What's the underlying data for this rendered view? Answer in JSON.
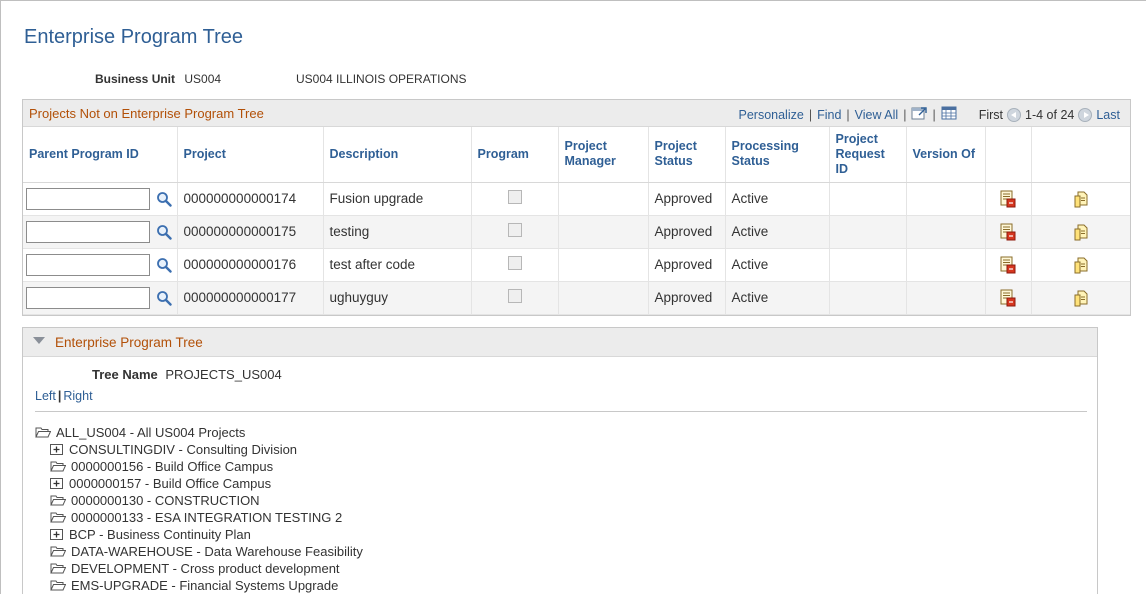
{
  "page": {
    "title": "Enterprise Program Tree"
  },
  "business_unit": {
    "label": "Business Unit",
    "code": "US004",
    "description": "US004 ILLINOIS OPERATIONS"
  },
  "grid": {
    "title": "Projects Not on Enterprise Program Tree",
    "nav": {
      "personalize": "Personalize",
      "find": "Find",
      "view_all": "View All",
      "first": "First",
      "range": "1-4 of 24",
      "last": "Last"
    },
    "columns": {
      "parent_program_id": "Parent Program ID",
      "project": "Project",
      "description": "Description",
      "program": "Program",
      "project_manager": "Project Manager",
      "project_status": "Project Status",
      "processing_status": "Processing Status",
      "project_request_id": "Project Request ID",
      "version_of": "Version Of"
    },
    "rows": [
      {
        "parent_program_id": "",
        "project": "000000000000174",
        "description": "Fusion upgrade",
        "program_checked": false,
        "project_manager": "",
        "project_status": "Approved",
        "processing_status": "Active",
        "project_request_id": "",
        "version_of": ""
      },
      {
        "parent_program_id": "",
        "project": "000000000000175",
        "description": "testing",
        "program_checked": false,
        "project_manager": "",
        "project_status": "Approved",
        "processing_status": "Active",
        "project_request_id": "",
        "version_of": ""
      },
      {
        "parent_program_id": "",
        "project": "000000000000176",
        "description": "test after code",
        "program_checked": false,
        "project_manager": "",
        "project_status": "Approved",
        "processing_status": "Active",
        "project_request_id": "",
        "version_of": ""
      },
      {
        "parent_program_id": "",
        "project": "000000000000177",
        "description": "ughuyguy",
        "program_checked": false,
        "project_manager": "",
        "project_status": "Approved",
        "processing_status": "Active",
        "project_request_id": "",
        "version_of": ""
      }
    ]
  },
  "tree": {
    "section_title": "Enterprise Program Tree",
    "tree_name_label": "Tree Name",
    "tree_name": "PROJECTS_US004",
    "left": "Left",
    "right": "Right",
    "root": {
      "label": "ALL_US004 - All US004 Projects",
      "icon": "folder-open-icon"
    },
    "nodes": [
      {
        "label": "CONSULTINGDIV - Consulting Division",
        "icon": "expand-plus-icon"
      },
      {
        "label": "0000000156 - Build Office Campus",
        "icon": "folder-open-icon"
      },
      {
        "label": "0000000157 - Build Office Campus",
        "icon": "expand-plus-icon"
      },
      {
        "label": "0000000130 - CONSTRUCTION",
        "icon": "folder-open-icon"
      },
      {
        "label": "0000000133 - ESA INTEGRATION TESTING 2",
        "icon": "folder-open-icon"
      },
      {
        "label": "BCP - Business Continuity Plan",
        "icon": "expand-plus-icon"
      },
      {
        "label": "DATA-WAREHOUSE - Data Warehouse Feasibility",
        "icon": "folder-open-icon"
      },
      {
        "label": "DEVELOPMENT - Cross product development",
        "icon": "folder-open-icon"
      },
      {
        "label": "EMS-UPGRADE - Financial Systems Upgrade",
        "icon": "folder-open-icon"
      }
    ]
  },
  "colors": {
    "title_blue": "#2f5f95",
    "section_orange": "#b25008",
    "header_bg": "#ececec"
  }
}
